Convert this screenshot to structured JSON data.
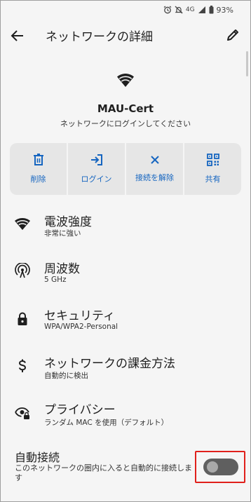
{
  "status_bar": {
    "network_type": "4G",
    "battery": "93%"
  },
  "app_bar": {
    "title": "ネットワークの詳細",
    "back_icon": "arrow-back-icon",
    "edit_icon": "pencil-icon"
  },
  "network": {
    "name": "MAU-Cert",
    "status": "ネットワークにログインしてください",
    "icon": "wifi-icon"
  },
  "actions": [
    {
      "label": "削除",
      "icon": "trash-icon"
    },
    {
      "label": "ログイン",
      "icon": "login-icon"
    },
    {
      "label": "接続を解除",
      "icon": "close-icon"
    },
    {
      "label": "共有",
      "icon": "qr-code-icon"
    }
  ],
  "details": [
    {
      "title": "電波強度",
      "value": "非常に強い",
      "icon": "wifi-icon"
    },
    {
      "title": "周波数",
      "value": "5 GHz",
      "icon": "antenna-icon"
    },
    {
      "title": "セキュリティ",
      "value": "WPA/WPA2-Personal",
      "icon": "lock-icon"
    },
    {
      "title": "ネットワークの課金方法",
      "value": "自動的に検出",
      "icon": "dollar-icon"
    },
    {
      "title": "プライバシー",
      "value": "ランダム MAC を使用（デフォルト）",
      "icon": "eye-lock-icon"
    }
  ],
  "auto_connect": {
    "title": "自動接続",
    "description": "このネットワークの圏内に入ると自動的に接続します",
    "enabled": false
  },
  "colors": {
    "accent": "#1565c0",
    "highlight": "#e0201b",
    "background": "#f5f5f5",
    "action_tile": "#e6e6e6"
  }
}
